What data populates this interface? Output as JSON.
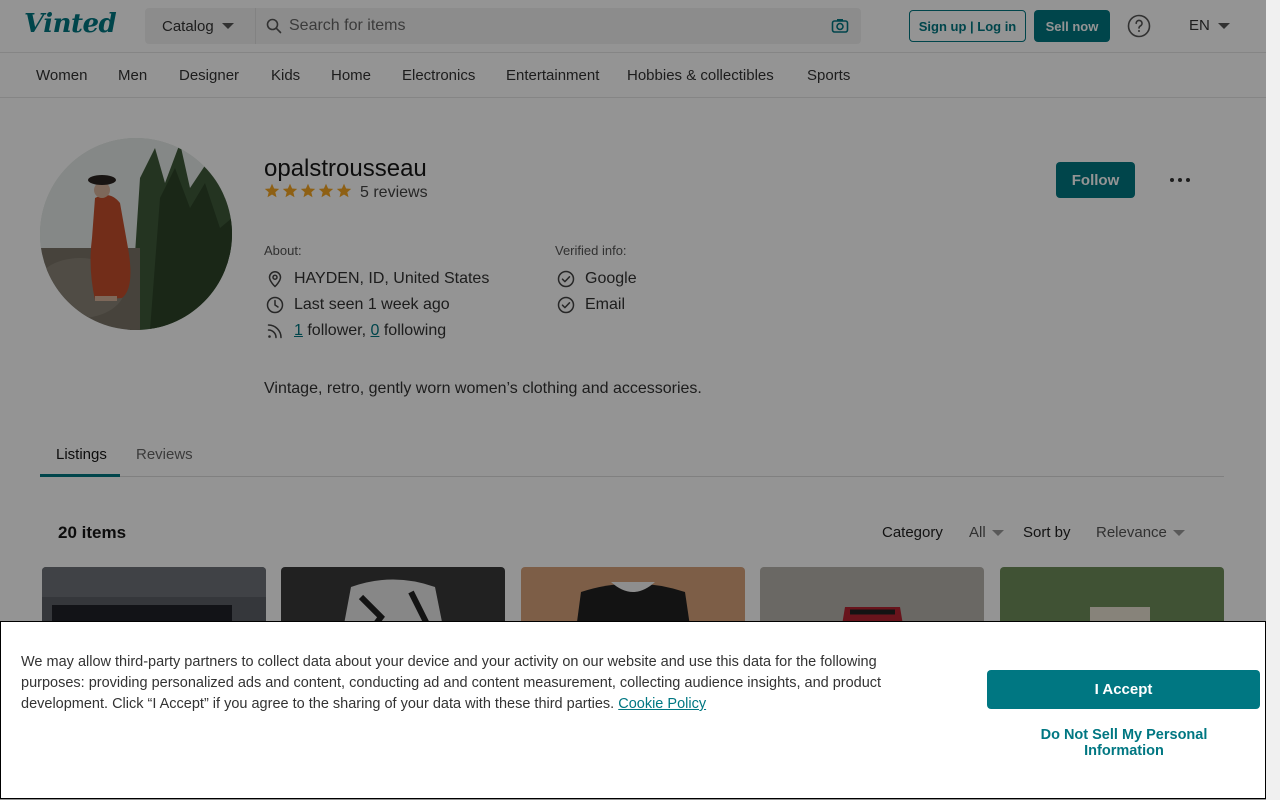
{
  "header": {
    "logo": "Vinted",
    "catalog_label": "Catalog",
    "search_placeholder": "Search for items",
    "signup_label": "Sign up | Log in",
    "sell_label": "Sell now",
    "language": "EN"
  },
  "nav": {
    "items": [
      "Women",
      "Men",
      "Designer",
      "Kids",
      "Home",
      "Electronics",
      "Entertainment",
      "Hobbies & collectibles",
      "Sports"
    ]
  },
  "profile": {
    "username": "opalstrousseau",
    "rating_stars": 5,
    "reviews": "5 reviews",
    "follow_label": "Follow",
    "about_label": "About:",
    "location": "HAYDEN, ID, United States",
    "last_seen": "Last seen 1 week ago",
    "followers_count": "1",
    "followers_text": " follower, ",
    "following_count": "0",
    "following_text": " following",
    "verified_label": "Verified info:",
    "verified": [
      "Google",
      "Email"
    ],
    "bio": "Vintage, retro, gently worn women’s clothing and accessories."
  },
  "tabs": [
    "Listings",
    "Reviews"
  ],
  "listings": {
    "count": "20 items",
    "category_label": "Category",
    "category_value": "All",
    "sort_label": "Sort by",
    "sort_value": "Relevance"
  },
  "cookie": {
    "text": "We may allow third-party partners to collect data about your device and your activity on our website and use this data for the following purposes: providing personalized ads and content, conducting ad and content measurement, collecting audience insights, and product development. Click “I Accept” if you agree to the sharing of your data with these third parties. ",
    "policy_link": "Cookie Policy",
    "accept_label": "I Accept",
    "do_not_sell_label": "Do Not Sell My Personal Information"
  },
  "colors": {
    "brand": "#007782",
    "star": "#f5a623"
  }
}
